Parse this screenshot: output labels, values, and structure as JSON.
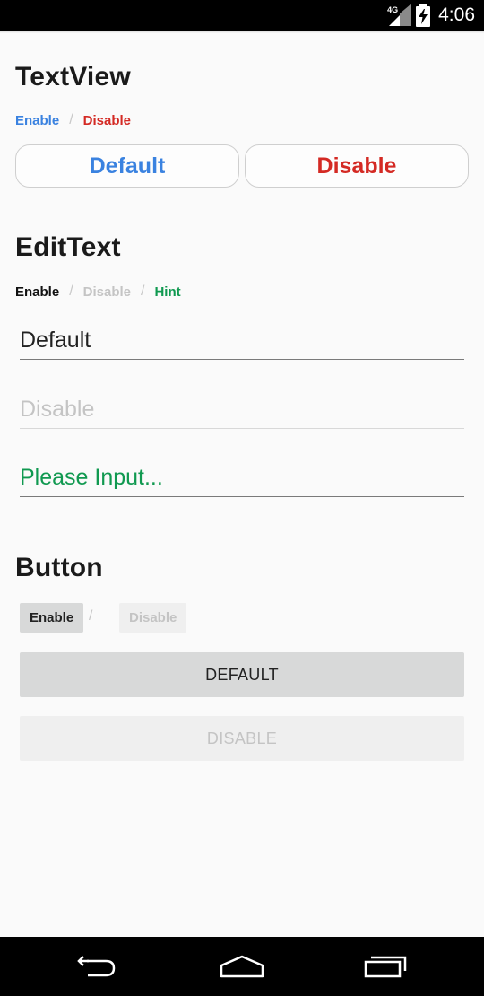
{
  "status_bar": {
    "network": "4G",
    "clock": "4:06",
    "icons": [
      "signal-icon",
      "battery-charging-icon"
    ]
  },
  "textview": {
    "title": "TextView",
    "label_enable": "Enable",
    "label_separator": "/",
    "label_disable": "Disable",
    "button_default": "Default",
    "button_disable": "Disable"
  },
  "edittext": {
    "title": "EditText",
    "label_enable": "Enable",
    "label_separator_1": "/",
    "label_disable": "Disable",
    "label_separator_2": "/",
    "label_hint": "Hint",
    "field_default_value": "Default",
    "field_disable_value": "Disable",
    "field_hint_placeholder": "Please Input..."
  },
  "button": {
    "title": "Button",
    "small_enable": "Enable",
    "label_separator": "/",
    "small_disable": "Disable",
    "wide_default": "DEFAULT",
    "wide_disable": "DISABLE"
  },
  "nav_bar": {
    "icons": [
      "back-icon",
      "home-icon",
      "recent-apps-icon"
    ]
  },
  "colors": {
    "enable_blue": "#3a82e0",
    "disable_red": "#d42a24",
    "hint_green": "#109950",
    "disabled_gray": "#c4c4c4",
    "button_bg": "#d8d9d9",
    "button_disabled_bg": "#efefef"
  }
}
